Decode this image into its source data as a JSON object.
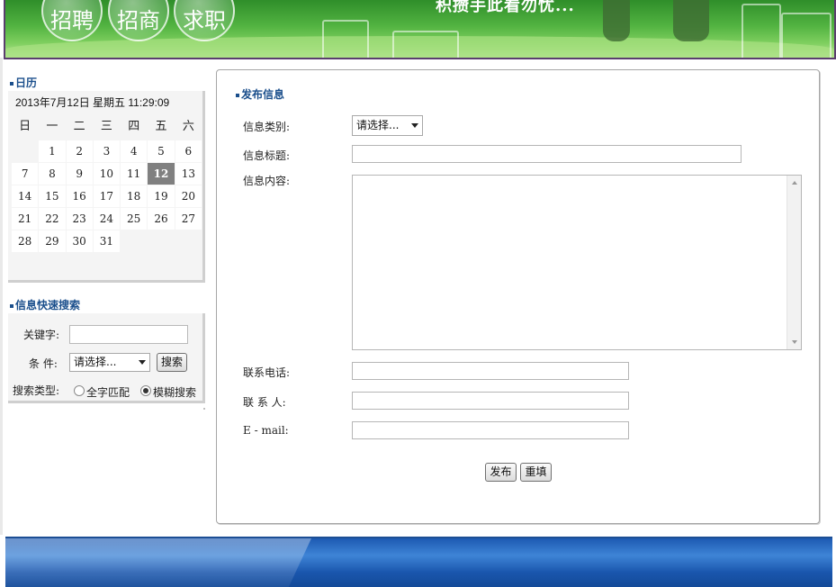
{
  "banner": {
    "nav": [
      "招聘",
      "招商",
      "求职"
    ],
    "slogan": "积攒手此看勿忧..."
  },
  "calendar": {
    "title": "日历",
    "datetime": "2013年7月12日 星期五  11:29:09",
    "weekdays": [
      "日",
      "一",
      "二",
      "三",
      "四",
      "五",
      "六"
    ],
    "weeks": [
      [
        "",
        "1",
        "2",
        "3",
        "4",
        "5",
        "6"
      ],
      [
        "7",
        "8",
        "9",
        "10",
        "11",
        "12",
        "13"
      ],
      [
        "14",
        "15",
        "16",
        "17",
        "18",
        "19",
        "20"
      ],
      [
        "21",
        "22",
        "23",
        "24",
        "25",
        "26",
        "27"
      ],
      [
        "28",
        "29",
        "30",
        "31",
        "",
        "",
        ""
      ]
    ],
    "today": "12"
  },
  "quick_search": {
    "title": "信息快速搜索",
    "keyword_label": "关键字:",
    "keyword_value": "",
    "condition_label": "条 件:",
    "condition_selected": "请选择...",
    "search_button": "搜索",
    "type_label": "搜索类型:",
    "type_options": [
      "全字匹配",
      "模糊搜索"
    ],
    "type_selected": "模糊搜索"
  },
  "publish": {
    "title": "发布信息",
    "category_label": "信息类别:",
    "category_selected": "请选择...",
    "subject_label": "信息标题:",
    "subject_value": "",
    "content_label": "信息内容:",
    "content_value": "",
    "phone_label": "联系电话:",
    "phone_value": "",
    "contact_label": "联 系 人:",
    "contact_value": "",
    "email_label": "E - mail:",
    "email_value": "",
    "submit_button": "发布",
    "reset_button": "重填"
  }
}
